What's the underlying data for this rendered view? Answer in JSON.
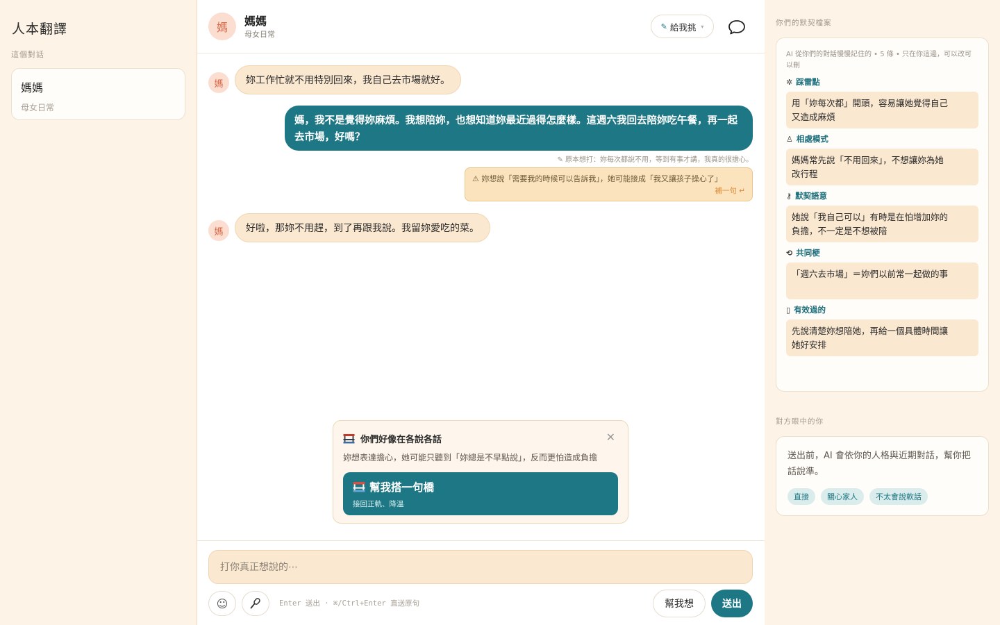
{
  "app": {
    "title": "人本翻譯"
  },
  "sidebar": {
    "section_label": "這個對話",
    "conversations": [
      {
        "name": "媽媽",
        "subtitle": "母女日常"
      }
    ]
  },
  "chat_header": {
    "avatar_char": "媽",
    "name": "媽媽",
    "subtitle": "母女日常",
    "give_button_label": "給我挑"
  },
  "messages": {
    "m1": {
      "avatar_char": "媽",
      "text": "妳工作忙就不用特別回來，我自己去市場就好。"
    },
    "m2": {
      "text": "媽，我不是覺得妳麻煩。我想陪妳，也想知道妳最近過得怎麼樣。這週六我回去陪妳吃午餐，再一起去市場，好嗎？"
    },
    "m2_note": "原本想打：妳每次都說不用，等到有事才講，我真的很擔心。",
    "m2_warning": "妳想說「需要我的時候可以告訴我」，她可能接成「我又讓孩子操心了」",
    "m2_warning_action": "補一句",
    "m3": {
      "avatar_char": "媽",
      "text": "好啦，那妳不用趕，到了再跟我說。我留妳愛吃的菜。"
    }
  },
  "popup": {
    "title": "你們好像在各說各話",
    "description": "妳想表達擔心，她可能只聽到「妳總是不早點說」，反而更怕造成負擔",
    "bridge_title": "幫我搭一句橋",
    "bridge_subtitle": "接回正軌、降溫"
  },
  "compose": {
    "placeholder": "打你真正想說的⋯",
    "hint": "Enter 送出 · ⌘/Ctrl+Enter 直送原句",
    "help_label": "幫我想",
    "send_label": "送出"
  },
  "right_panel": {
    "contract_label": "你們的默契檔案",
    "contract_meta": "AI 從你們的對話慢慢記住的 • 5 條 • 只在你這邊，可以改可以刪",
    "categories": [
      {
        "icon": "✲",
        "title": "踩雷點",
        "text": "用「妳每次都」開頭，容易讓她覺得自己又造成麻煩"
      },
      {
        "icon": "♙",
        "title": "相處模式",
        "text": "媽媽常先說「不用回來」，不想讓妳為她改行程"
      },
      {
        "icon": "⚷",
        "title": "默契語意",
        "text": "她說「我自己可以」有時是在怕增加妳的負擔，不一定是不想被陪"
      },
      {
        "icon": "⟲",
        "title": "共同梗",
        "text": "「週六去市場」＝妳們以前常一起做的事"
      },
      {
        "icon": "▯",
        "title": "有效過的",
        "text": "先說清楚妳想陪她，再給一個具體時間讓她好安排"
      }
    ],
    "eyes_label": "對方眼中的你",
    "eyes_text": "送出前，AI 會依你的人格與近期對話，幫你把話說準。",
    "tags": [
      "直接",
      "關心家人",
      "不太會說軟話"
    ]
  },
  "colors": {
    "accent": "#1d7784",
    "cream": "#fdf3e7",
    "peach": "#fbe8d0",
    "warning": "#fbe3bd"
  }
}
